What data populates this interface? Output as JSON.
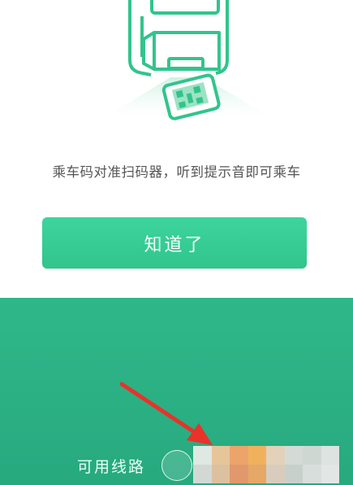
{
  "modal": {
    "instruction": "乘车码对准扫码器，听到提示音即可乘车",
    "confirm_label": "知道了"
  },
  "bottom_panel": {
    "route_label": "可用线路"
  },
  "colors": {
    "accent": "#33cc94",
    "illustration_stroke": "#32c48c",
    "panel": "#2bb084",
    "arrow": "#e8322a"
  },
  "icons": [
    "scanner-icon",
    "phone-qr-icon",
    "red-arrow-icon"
  ]
}
